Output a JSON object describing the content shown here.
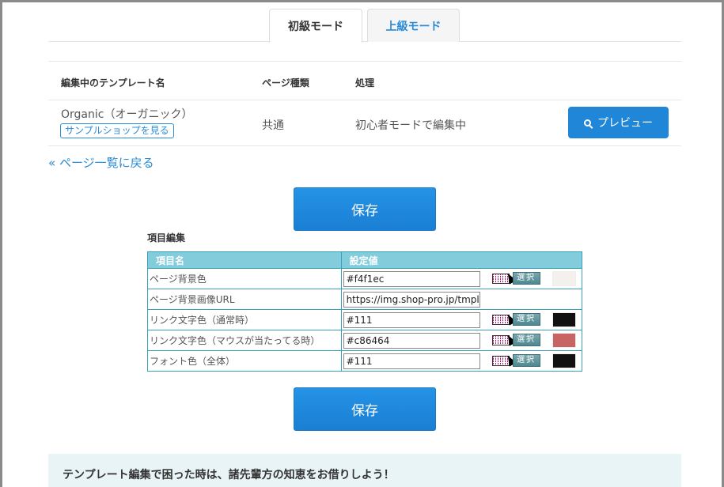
{
  "tabs": [
    {
      "label": "初級モード",
      "active": true
    },
    {
      "label": "上級モード",
      "active": false
    }
  ],
  "info_table": {
    "headers": [
      "編集中のテンプレート名",
      "ページ種類",
      "処理"
    ],
    "row": {
      "template_name": "Organic（オーガニック）",
      "sample_link": "サンプルショップを見る",
      "page_type": "共通",
      "process": "初心者モードで編集中",
      "preview_label": "プレビュー"
    }
  },
  "back_link": "« ページ一覧に戻る",
  "save_label": "保存",
  "section_title": "項目編集",
  "edit_table": {
    "headers": [
      "項目名",
      "設定値"
    ],
    "picker_label": "選択",
    "rows": [
      {
        "name": "ページ背景色",
        "value": "#f4f1ec",
        "swatch": "#f4f1ec",
        "picker": true
      },
      {
        "name": "ページ背景画像URL",
        "value": "https://img.shop-pro.jp/tmpl_",
        "picker": false
      },
      {
        "name": "リンク文字色（通常時）",
        "value": "#111",
        "swatch": "#111111",
        "picker": true
      },
      {
        "name": "リンク文字色（マウスが当たってる時）",
        "value": "#c86464",
        "swatch": "#c86464",
        "picker": true
      },
      {
        "name": "フォント色（全体）",
        "value": "#111",
        "swatch": "#111111",
        "picker": true
      }
    ]
  },
  "help_box": {
    "title": "テンプレート編集で困った時は、諸先輩方の知恵をお借りしよう！"
  }
}
